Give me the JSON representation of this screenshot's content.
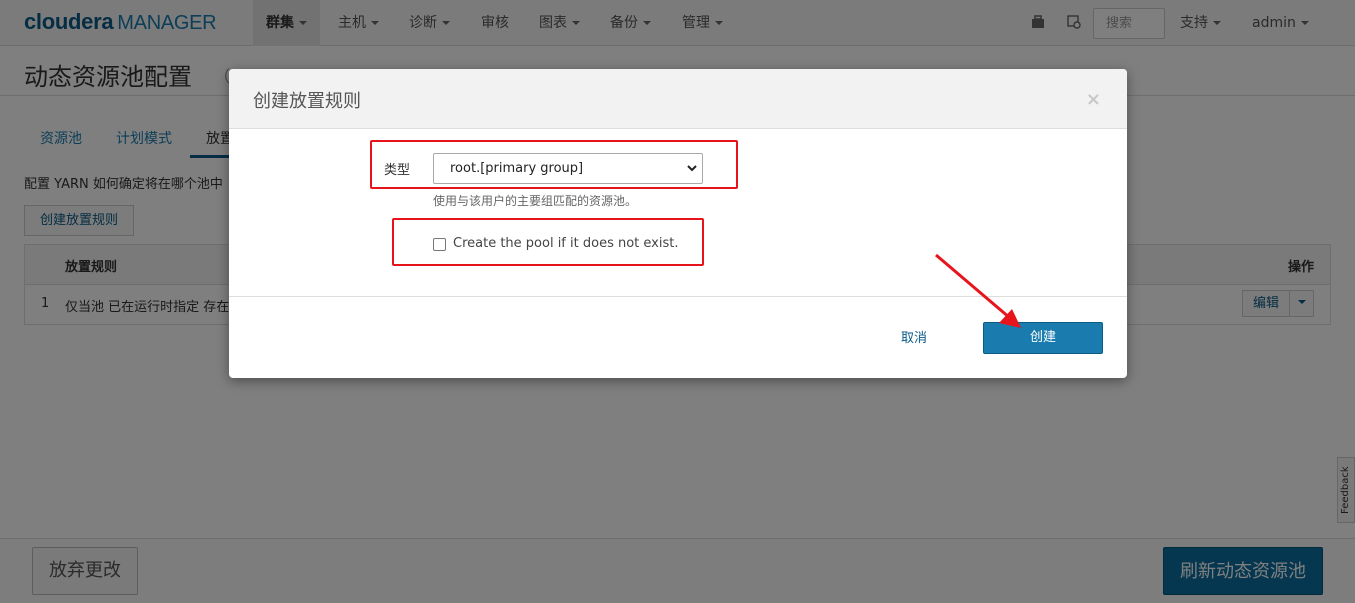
{
  "brand": {
    "part1": "cloudera",
    "part2": "MANAGER"
  },
  "nav": {
    "items": [
      {
        "label": "群集",
        "active": true
      },
      {
        "label": "主机"
      },
      {
        "label": "诊断"
      },
      {
        "label": "审核"
      },
      {
        "label": "图表"
      },
      {
        "label": "备份"
      },
      {
        "label": "管理"
      }
    ],
    "search_placeholder": "搜索",
    "support": "支持",
    "user": "admin"
  },
  "page": {
    "title": "动态资源池配置",
    "subtitle": "（"
  },
  "tabs": [
    "资源池",
    "计划模式",
    "放置"
  ],
  "description": "配置 YARN 如何确定将在哪个池中",
  "create_rule_button": "创建放置规则",
  "table": {
    "col_rule": "放置规则",
    "col_op": "操作",
    "rows": [
      {
        "num": "1",
        "text": "仅当池 已在运行时指定 存在"
      }
    ],
    "edit_label": "编辑"
  },
  "bottom": {
    "discard": "放弃更改",
    "refresh": "刷新动态资源池"
  },
  "feedback": "Feedback",
  "modal": {
    "title": "创建放置规则",
    "close": "×",
    "type_label": "类型",
    "type_value": "root.[primary group]",
    "help": "使用与该用户的主要组匹配的资源池。",
    "checkbox_label": "Create the pool if it does not exist.",
    "cancel": "取消",
    "create": "创建"
  },
  "colors": {
    "accent": "#1a7cae",
    "highlight": "#e8141c"
  }
}
